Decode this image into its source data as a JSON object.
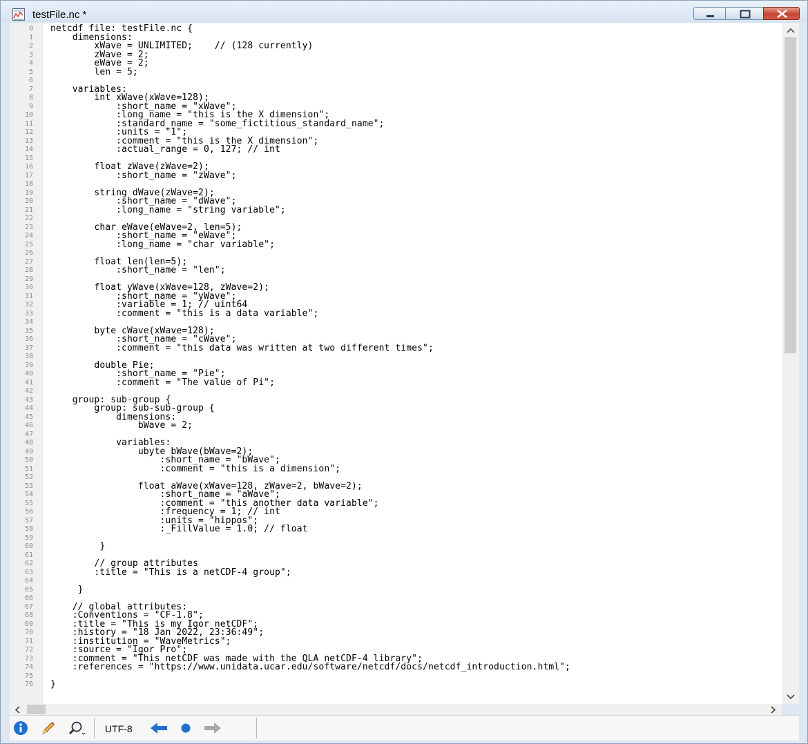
{
  "window": {
    "title": "testFile.nc *",
    "icon": "netcdf-file-icon",
    "close_color": "#c7432f"
  },
  "code_lines": [
    "netcdf file: testFile.nc {",
    "    dimensions:",
    "        xWave = UNLIMITED;    // (128 currently)",
    "        zWave = 2;",
    "        eWave = 2;",
    "        len = 5;",
    "",
    "    variables:",
    "        int xWave(xWave=128);",
    "            :short_name = \"xWave\";",
    "            :long_name = \"this is the X dimension\";",
    "            :standard_name = \"some_fictitious_standard_name\";",
    "            :units = \"1\";",
    "            :comment = \"this is the X dimension\";",
    "            :actual_range = 0, 127; // int",
    "",
    "        float zWave(zWave=2);",
    "            :short_name = \"zWave\";",
    "",
    "        string dWave(zWave=2);",
    "            :short_name = \"dWave\";",
    "            :long_name = \"string variable\";",
    "",
    "        char eWave(eWave=2, len=5);",
    "            :short_name = \"eWave\";",
    "            :long_name = \"char variable\";",
    "",
    "        float len(len=5);",
    "            :short_name = \"len\";",
    "",
    "        float yWave(xWave=128, zWave=2);",
    "            :short_name = \"yWave\";",
    "            :variable = 1; // uint64",
    "            :comment = \"this is a data variable\";",
    "",
    "        byte cWave(xWave=128);",
    "            :short_name = \"cWave\";",
    "            :comment = \"this data was written at two different times\";",
    "",
    "        double Pie;",
    "            :short_name = \"Pie\";",
    "            :comment = \"The value of Pi\";",
    "",
    "    group: sub-group {",
    "        group: sub-sub-group {",
    "            dimensions:",
    "                bWave = 2;",
    "",
    "            variables:",
    "                ubyte bWave(bWave=2);",
    "                    :short_name = \"bWave\";",
    "                    :comment = \"this is a dimension\";",
    "",
    "                float aWave(xWave=128, zWave=2, bWave=2);",
    "                    :short_name = \"aWave\";",
    "                    :comment = \"this another data variable\";",
    "                    :frequency = 1; // int",
    "                    :units = \"hippos\";",
    "                    :_FillValue = 1.0; // float",
    "",
    "         }",
    "",
    "        // group attributes",
    "        :title = \"This is a netCDF-4 group\";",
    "",
    "     }",
    "",
    "    // global attributes:",
    "    :Conventions = \"CF-1.8\";",
    "    :title = \"This is my Igor netCDF\";",
    "    :history = \"18 Jan 2022, 23:36:49\";",
    "    :institution = \"WaveMetrics\";",
    "    :source = \"Igor Pro\";",
    "    :comment = \"This netCDF was made with the QLA netCDF-4 library\";",
    "    :references = \"https://www.unidata.ucar.edu/software/netcdf/docs/netcdf_introduction.html\";",
    "",
    "}"
  ],
  "statusbar": {
    "encoding": "UTF-8",
    "icons": [
      "info-icon",
      "pencil-icon",
      "magnifier-icon",
      "back-arrow-icon",
      "dot-icon",
      "forward-arrow-icon"
    ],
    "accent": "#1f6fd0"
  }
}
